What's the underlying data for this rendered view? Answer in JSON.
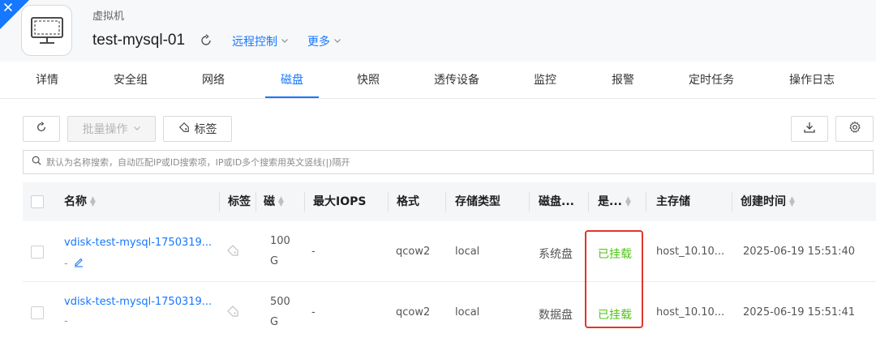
{
  "header": {
    "vm_type": "虚拟机",
    "vm_name": "test-mysql-01",
    "remote_control": "远程控制",
    "more": "更多"
  },
  "tabs": [
    {
      "label": "详情"
    },
    {
      "label": "安全组"
    },
    {
      "label": "网络"
    },
    {
      "label": "磁盘",
      "active": true
    },
    {
      "label": "快照"
    },
    {
      "label": "透传设备"
    },
    {
      "label": "监控"
    },
    {
      "label": "报警"
    },
    {
      "label": "定时任务"
    },
    {
      "label": "操作日志"
    }
  ],
  "toolbar": {
    "batch_ops": "批量操作",
    "tags": "标签"
  },
  "search": {
    "placeholder": "默认为名称搜索，自动匹配IP或ID搜索项，IP或ID多个搜索用英文竖线(|)隔开"
  },
  "table": {
    "headers": {
      "name": "名称",
      "tag": "标签",
      "size": "磁",
      "max_iops": "最大IOPS",
      "format": "格式",
      "storage_type": "存储类型",
      "disk_type": "磁盘...",
      "mounted": "是...",
      "primary_storage": "主存储",
      "created": "创建时间"
    },
    "rows": [
      {
        "name": "vdisk-test-mysql-1750319...",
        "desc": "-",
        "size_num": "100",
        "size_unit": "G",
        "max_iops": "-",
        "format": "qcow2",
        "storage_type": "local",
        "disk_type": "系统盘",
        "mounted": "已挂载",
        "primary_storage": "host_10.10...",
        "created": "2025-06-19 15:51:40"
      },
      {
        "name": "vdisk-test-mysql-1750319...",
        "desc": "-",
        "size_num": "500",
        "size_unit": "G",
        "max_iops": "-",
        "format": "qcow2",
        "storage_type": "local",
        "disk_type": "数据盘",
        "mounted": "已挂载",
        "primary_storage": "host_10.10...",
        "created": "2025-06-19 15:51:41"
      }
    ]
  },
  "colors": {
    "accent": "#1677ff",
    "status_ok": "#52c41a",
    "highlight": "#e0352b"
  }
}
